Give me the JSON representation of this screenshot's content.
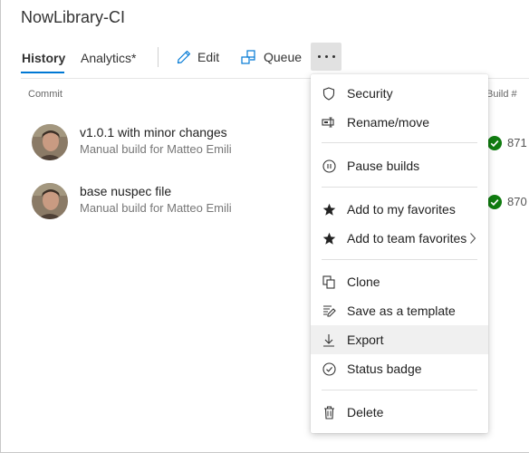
{
  "app": {
    "title": "NowLibrary-CI"
  },
  "tabs": [
    {
      "label": "History",
      "active": true
    },
    {
      "label": "Analytics*",
      "active": false
    }
  ],
  "toolbar": {
    "edit_label": "Edit",
    "queue_label": "Queue",
    "more_icon": "ellipsis-icon"
  },
  "table": {
    "columns": {
      "commit": "Commit",
      "build": "Build #"
    },
    "rows": [
      {
        "title": "v1.0.1 with minor changes",
        "subtitle": "Manual build for Matteo Emili",
        "status": "succeeded",
        "build": "871"
      },
      {
        "title": "base nuspec file",
        "subtitle": "Manual build for Matteo Emili",
        "status": "succeeded",
        "build": "870"
      }
    ]
  },
  "menu": {
    "items": [
      {
        "label": "Security",
        "icon": "shield-icon"
      },
      {
        "label": "Rename/move",
        "icon": "rename-icon"
      },
      {
        "label": "Pause builds",
        "icon": "pause-icon"
      },
      {
        "label": "Add to my favorites",
        "icon": "star-icon"
      },
      {
        "label": "Add to team favorites",
        "icon": "star-icon",
        "submenu": true
      },
      {
        "label": "Clone",
        "icon": "clone-icon"
      },
      {
        "label": "Save as a template",
        "icon": "template-icon"
      },
      {
        "label": "Export",
        "icon": "download-icon",
        "highlighted": true
      },
      {
        "label": "Status badge",
        "icon": "check-circle-icon"
      },
      {
        "label": "Delete",
        "icon": "trash-icon"
      }
    ]
  },
  "colors": {
    "accent": "#0078d4",
    "success": "#107c10",
    "menu_highlight": "#f0f0f0"
  }
}
